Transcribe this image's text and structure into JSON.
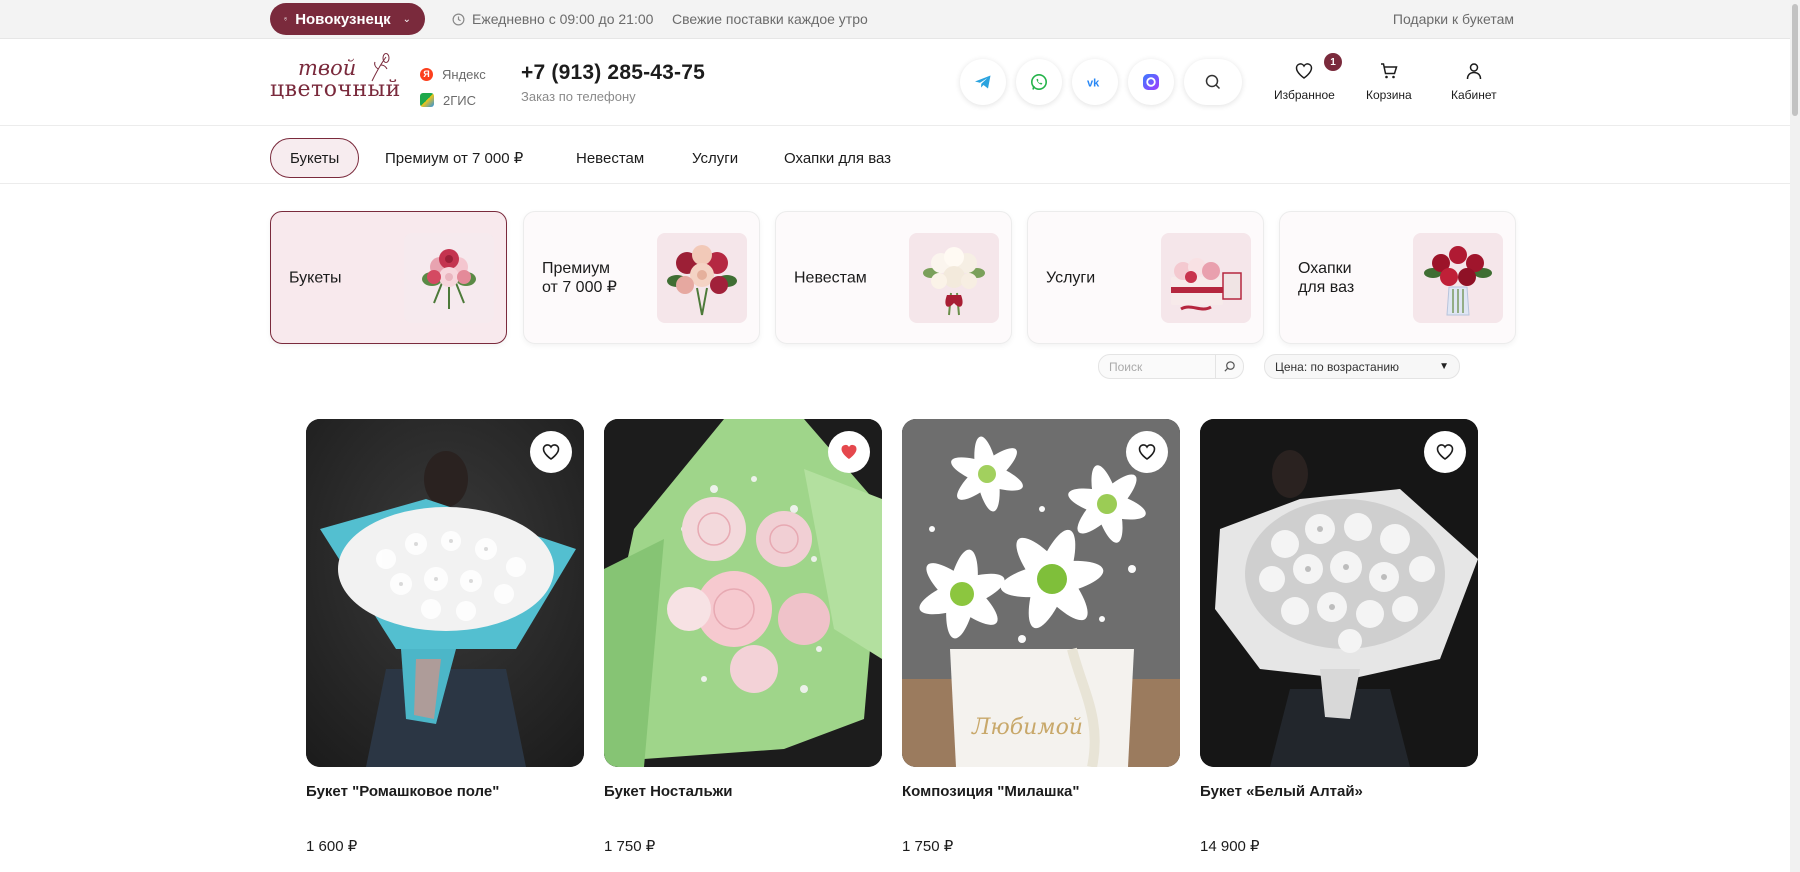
{
  "topbar": {
    "city": "Новокузнецк",
    "hours": "Ежедневно с 09:00 до 21:00",
    "fresh": "Свежие поставки каждое утро",
    "gifts": "Подарки к букетам"
  },
  "header": {
    "logo_line1": "твой",
    "logo_line2": "цветочный",
    "yandex": "Яндекс",
    "gis": "2ГИС",
    "phone": "+7 (913) 285-43-75",
    "phone_sub": "Заказ по телефону",
    "favorites_label": "Избранное",
    "favorites_count": "1",
    "cart_label": "Корзина",
    "cabinet_label": "Кабинет",
    "social_icons": [
      "telegram-icon",
      "whatsapp-icon",
      "vk-icon",
      "max-icon",
      "search-icon"
    ]
  },
  "nav": {
    "items": [
      "Букеты",
      "Премиум от 7 000 ₽",
      "Невестам",
      "Услуги",
      "Охапки для ваз"
    ],
    "active": "Букеты"
  },
  "categories": [
    {
      "line1": "Букеты",
      "line2": ""
    },
    {
      "line1": "Премиум",
      "line2": "от 7 000 ₽"
    },
    {
      "line1": "Невестам",
      "line2": ""
    },
    {
      "line1": "Услуги",
      "line2": ""
    },
    {
      "line1": "Охапки",
      "line2": "для ваз"
    }
  ],
  "filters": {
    "search_placeholder": "Поиск",
    "sort_label": "Цена: по возрастанию"
  },
  "products": [
    {
      "name": "Букет \"Ромашковое поле\"",
      "price": "1 600 ₽",
      "favorited": false
    },
    {
      "name": "Букет Ностальжи",
      "price": "1 750 ₽",
      "favorited": true
    },
    {
      "name": "Композиция \"Милашка\"",
      "price": "1 750 ₽",
      "favorited": false
    },
    {
      "name": "Букет «Белый Алтай»",
      "price": "14 900 ₽",
      "favorited": false
    }
  ],
  "colors": {
    "accent": "#7a2a3c",
    "heart_active": "#e5484d"
  }
}
